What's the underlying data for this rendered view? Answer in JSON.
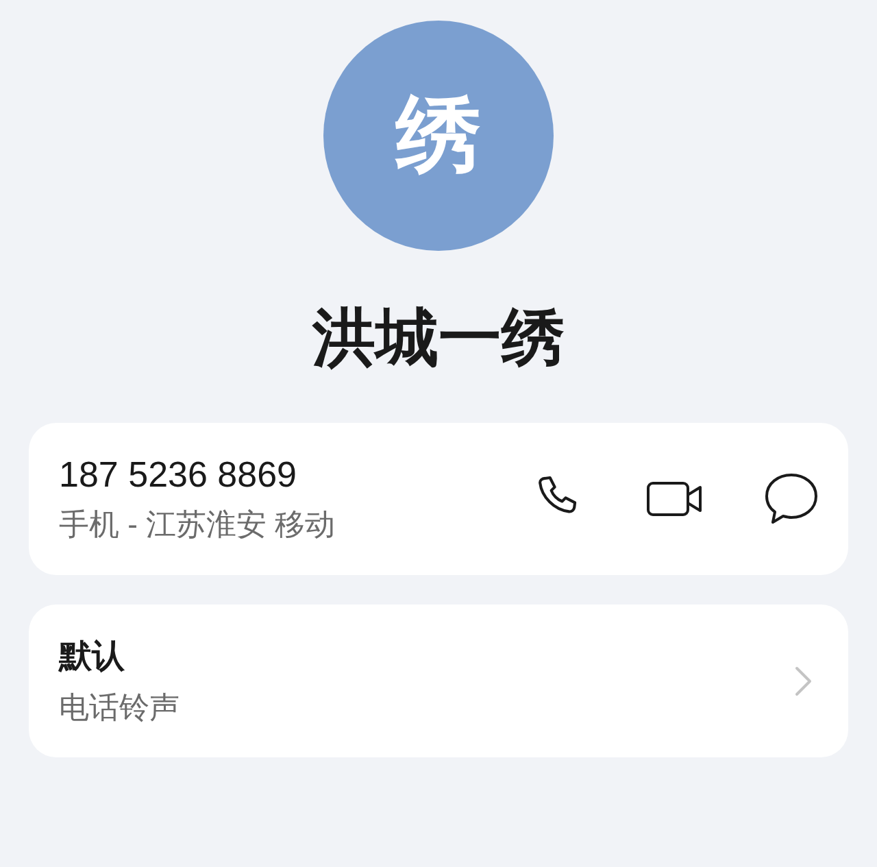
{
  "avatar": {
    "initial": "绣",
    "color": "#7b9fd0"
  },
  "contact": {
    "name": "洪城一绣"
  },
  "phone": {
    "number": "187 5236 8869",
    "detail": "手机 - 江苏淮安 移动"
  },
  "ringtone": {
    "value": "默认",
    "label": "电话铃声"
  }
}
